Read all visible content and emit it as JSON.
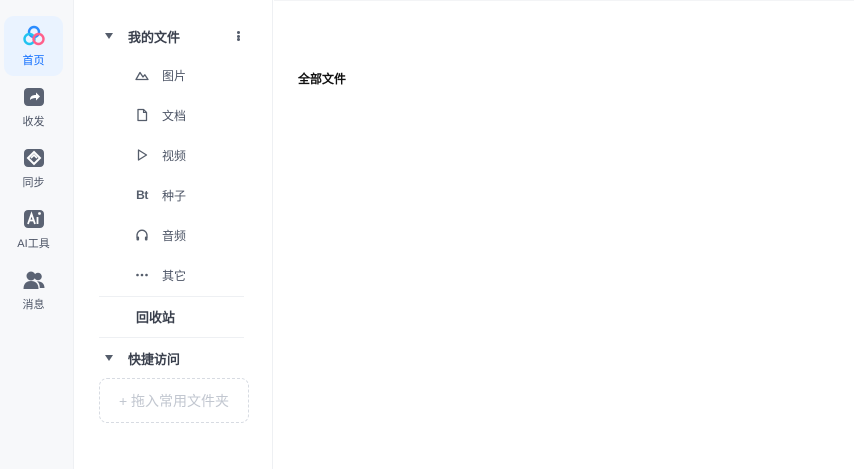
{
  "rail": {
    "items": [
      {
        "label": "首页",
        "icon": "home-logo-icon",
        "active": true
      },
      {
        "label": "收发",
        "icon": "share-folder-icon"
      },
      {
        "label": "同步",
        "icon": "sync-icon"
      },
      {
        "label": "AI工具",
        "icon": "ai-tools-icon"
      },
      {
        "label": "消息",
        "icon": "messages-icon"
      }
    ]
  },
  "nav": {
    "my_files": "我的文件",
    "items": [
      {
        "label": "图片",
        "icon": "image-icon"
      },
      {
        "label": "文档",
        "icon": "document-icon"
      },
      {
        "label": "视频",
        "icon": "video-play-icon"
      },
      {
        "label": "种子",
        "icon": "bt-icon",
        "glyph": "Bt"
      },
      {
        "label": "音频",
        "icon": "headphones-icon"
      },
      {
        "label": "其它",
        "icon": "more-dots-icon"
      }
    ],
    "trash": "回收站",
    "quick_access": "快捷访问",
    "drop_hint": "+ 拖入常用文件夹"
  },
  "main": {
    "title": "全部文件"
  },
  "colors": {
    "accent": "#0b6bff",
    "rail_bg": "#f7f8fa",
    "active_bg": "#eaf3ff",
    "text": "#4d5566"
  }
}
